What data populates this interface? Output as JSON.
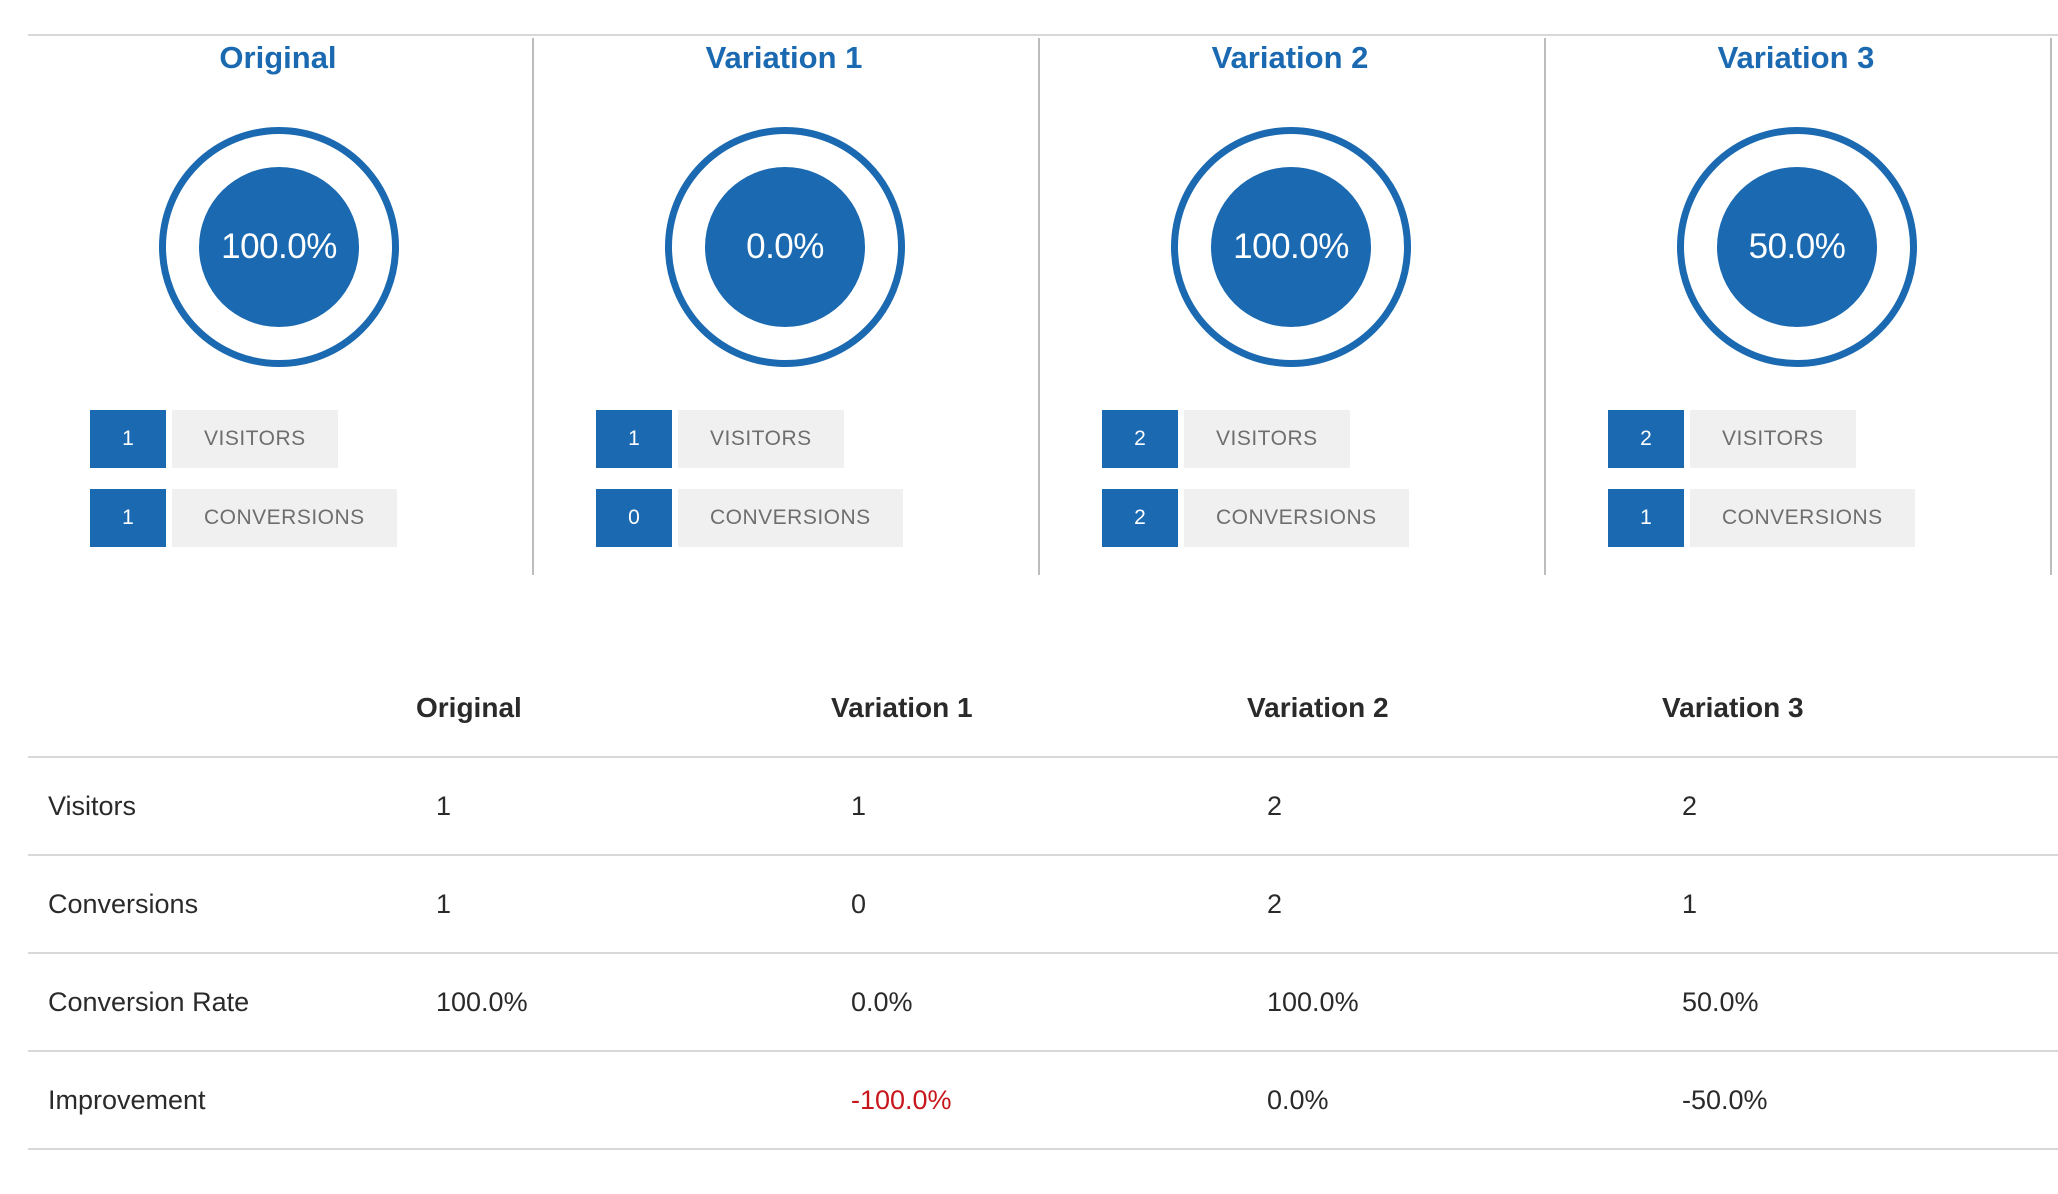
{
  "accent_color": "#1a69b1",
  "negative_color": "#c8161d",
  "variations": [
    {
      "name": "Original",
      "rate": "100.0%",
      "visitors": "1",
      "conversions": "1"
    },
    {
      "name": "Variation 1",
      "rate": "0.0%",
      "visitors": "1",
      "conversions": "0"
    },
    {
      "name": "Variation 2",
      "rate": "100.0%",
      "visitors": "2",
      "conversions": "2"
    },
    {
      "name": "Variation 3",
      "rate": "50.0%",
      "visitors": "2",
      "conversions": "1"
    }
  ],
  "stat_labels": {
    "visitors": "VISITORS",
    "conversions": "CONVERSIONS"
  },
  "table": {
    "headers": [
      "",
      "Original",
      "Variation 1",
      "Variation 2",
      "Variation 3"
    ],
    "rows": [
      {
        "label": "Visitors",
        "values": [
          "1",
          "1",
          "2",
          "2"
        ],
        "negative": [
          false,
          false,
          false,
          false
        ]
      },
      {
        "label": "Conversions",
        "values": [
          "1",
          "0",
          "2",
          "1"
        ],
        "negative": [
          false,
          false,
          false,
          false
        ]
      },
      {
        "label": "Conversion Rate",
        "values": [
          "100.0%",
          "0.0%",
          "100.0%",
          "50.0%"
        ],
        "negative": [
          false,
          false,
          false,
          false
        ]
      },
      {
        "label": "Improvement",
        "values": [
          "",
          "-100.0%",
          "0.0%",
          "-50.0%"
        ],
        "negative": [
          false,
          true,
          false,
          false
        ]
      }
    ]
  }
}
